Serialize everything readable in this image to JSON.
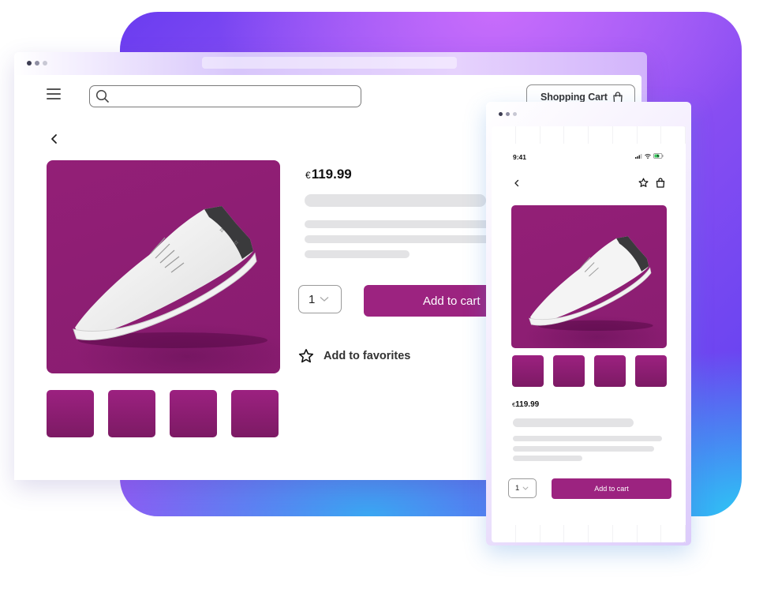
{
  "desktop": {
    "window_dots": [
      "#3d3d52",
      "#8f8fa3",
      "#c8c8d4"
    ],
    "search": {
      "placeholder": ""
    },
    "cart_button": {
      "label": "Shopping Cart",
      "icon": "shopping-bag-icon"
    },
    "back_icon": "chevron-left-icon",
    "product": {
      "price_currency": "€",
      "price_value": "119.99",
      "quantity": "1",
      "add_to_cart_label": "Add to cart",
      "favorites_label": "Add to favorites",
      "thumbnails": 4
    }
  },
  "mobile": {
    "window_dots": [
      "#3d3d52",
      "#8f8fa3",
      "#c8c8d4"
    ],
    "status_time": "9:41",
    "product": {
      "price_currency": "€",
      "price_value": "119.99",
      "quantity": "1",
      "add_to_cart_label": "Add to cart",
      "thumbnails": 4
    }
  },
  "colors": {
    "brand": "#9c2380",
    "product_bg": "#8d1e73",
    "skeleton": "#e3e3e5"
  }
}
